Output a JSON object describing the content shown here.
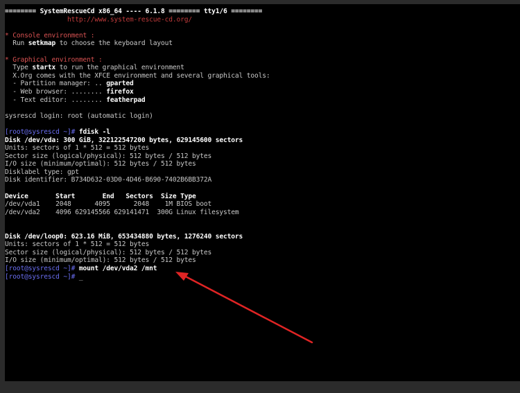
{
  "colors": {
    "background": "#2b2b2b",
    "terminal": "#000000",
    "text": "#c9c9c9",
    "bold_text": "#ffffff",
    "heading": "#d95252",
    "prompt": "#6a6ef2",
    "url": "#c03b3b",
    "arrow": "#e02424"
  },
  "header": {
    "title_line": "======== SystemRescueCd x86_64 ---- 6.1.8 ======== tty1/6 ========",
    "url": "http://www.system-rescue-cd.org/"
  },
  "console_section": {
    "heading": "* Console environment :",
    "run_pre": "  Run ",
    "run_cmd": "setkmap",
    "run_post": " to choose the keyboard layout"
  },
  "graphical_section": {
    "heading": "* Graphical environment :",
    "type_pre": "  Type ",
    "type_cmd": "startx",
    "type_post": " to run the graphical environment",
    "xorg_line": "  X.Org comes with the XFCE environment and several graphical tools:",
    "tools": [
      {
        "label": "  - Partition manager: .. ",
        "value": "gparted"
      },
      {
        "label": "  - Web browser: ........ ",
        "value": "firefox"
      },
      {
        "label": "  - Text editor: ........ ",
        "value": "featherpad"
      }
    ]
  },
  "login_line": "sysrescd login: root (automatic login)",
  "prompt": "[root@sysrescd ~]#",
  "fdisk": {
    "command": " fdisk -l",
    "disk_header": "Disk /dev/vda: 300 GiB, 322122547200 bytes, 629145600 sectors",
    "info": [
      "Units: sectors of 1 * 512 = 512 bytes",
      "Sector size (logical/physical): 512 bytes / 512 bytes",
      "I/O size (minimum/optimal): 512 bytes / 512 bytes",
      "Disklabel type: gpt",
      "Disk identifier: B734D632-03D0-4D46-B690-7402B6BB372A"
    ],
    "table_header": "Device       Start       End   Sectors  Size Type",
    "rows": [
      "/dev/vda1    2048      4095      2048    1M BIOS boot",
      "/dev/vda2    4096 629145566 629141471  300G Linux filesystem"
    ]
  },
  "loop": {
    "disk_header": "Disk /dev/loop0: 623.16 MiB, 653434880 bytes, 1276240 sectors",
    "info": [
      "Units: sectors of 1 * 512 = 512 bytes",
      "Sector size (logical/physical): 512 bytes / 512 bytes",
      "I/O size (minimum/optimal): 512 bytes / 512 bytes"
    ]
  },
  "mount_command": " mount /dev/vda2 /mnt",
  "cursor": " _"
}
